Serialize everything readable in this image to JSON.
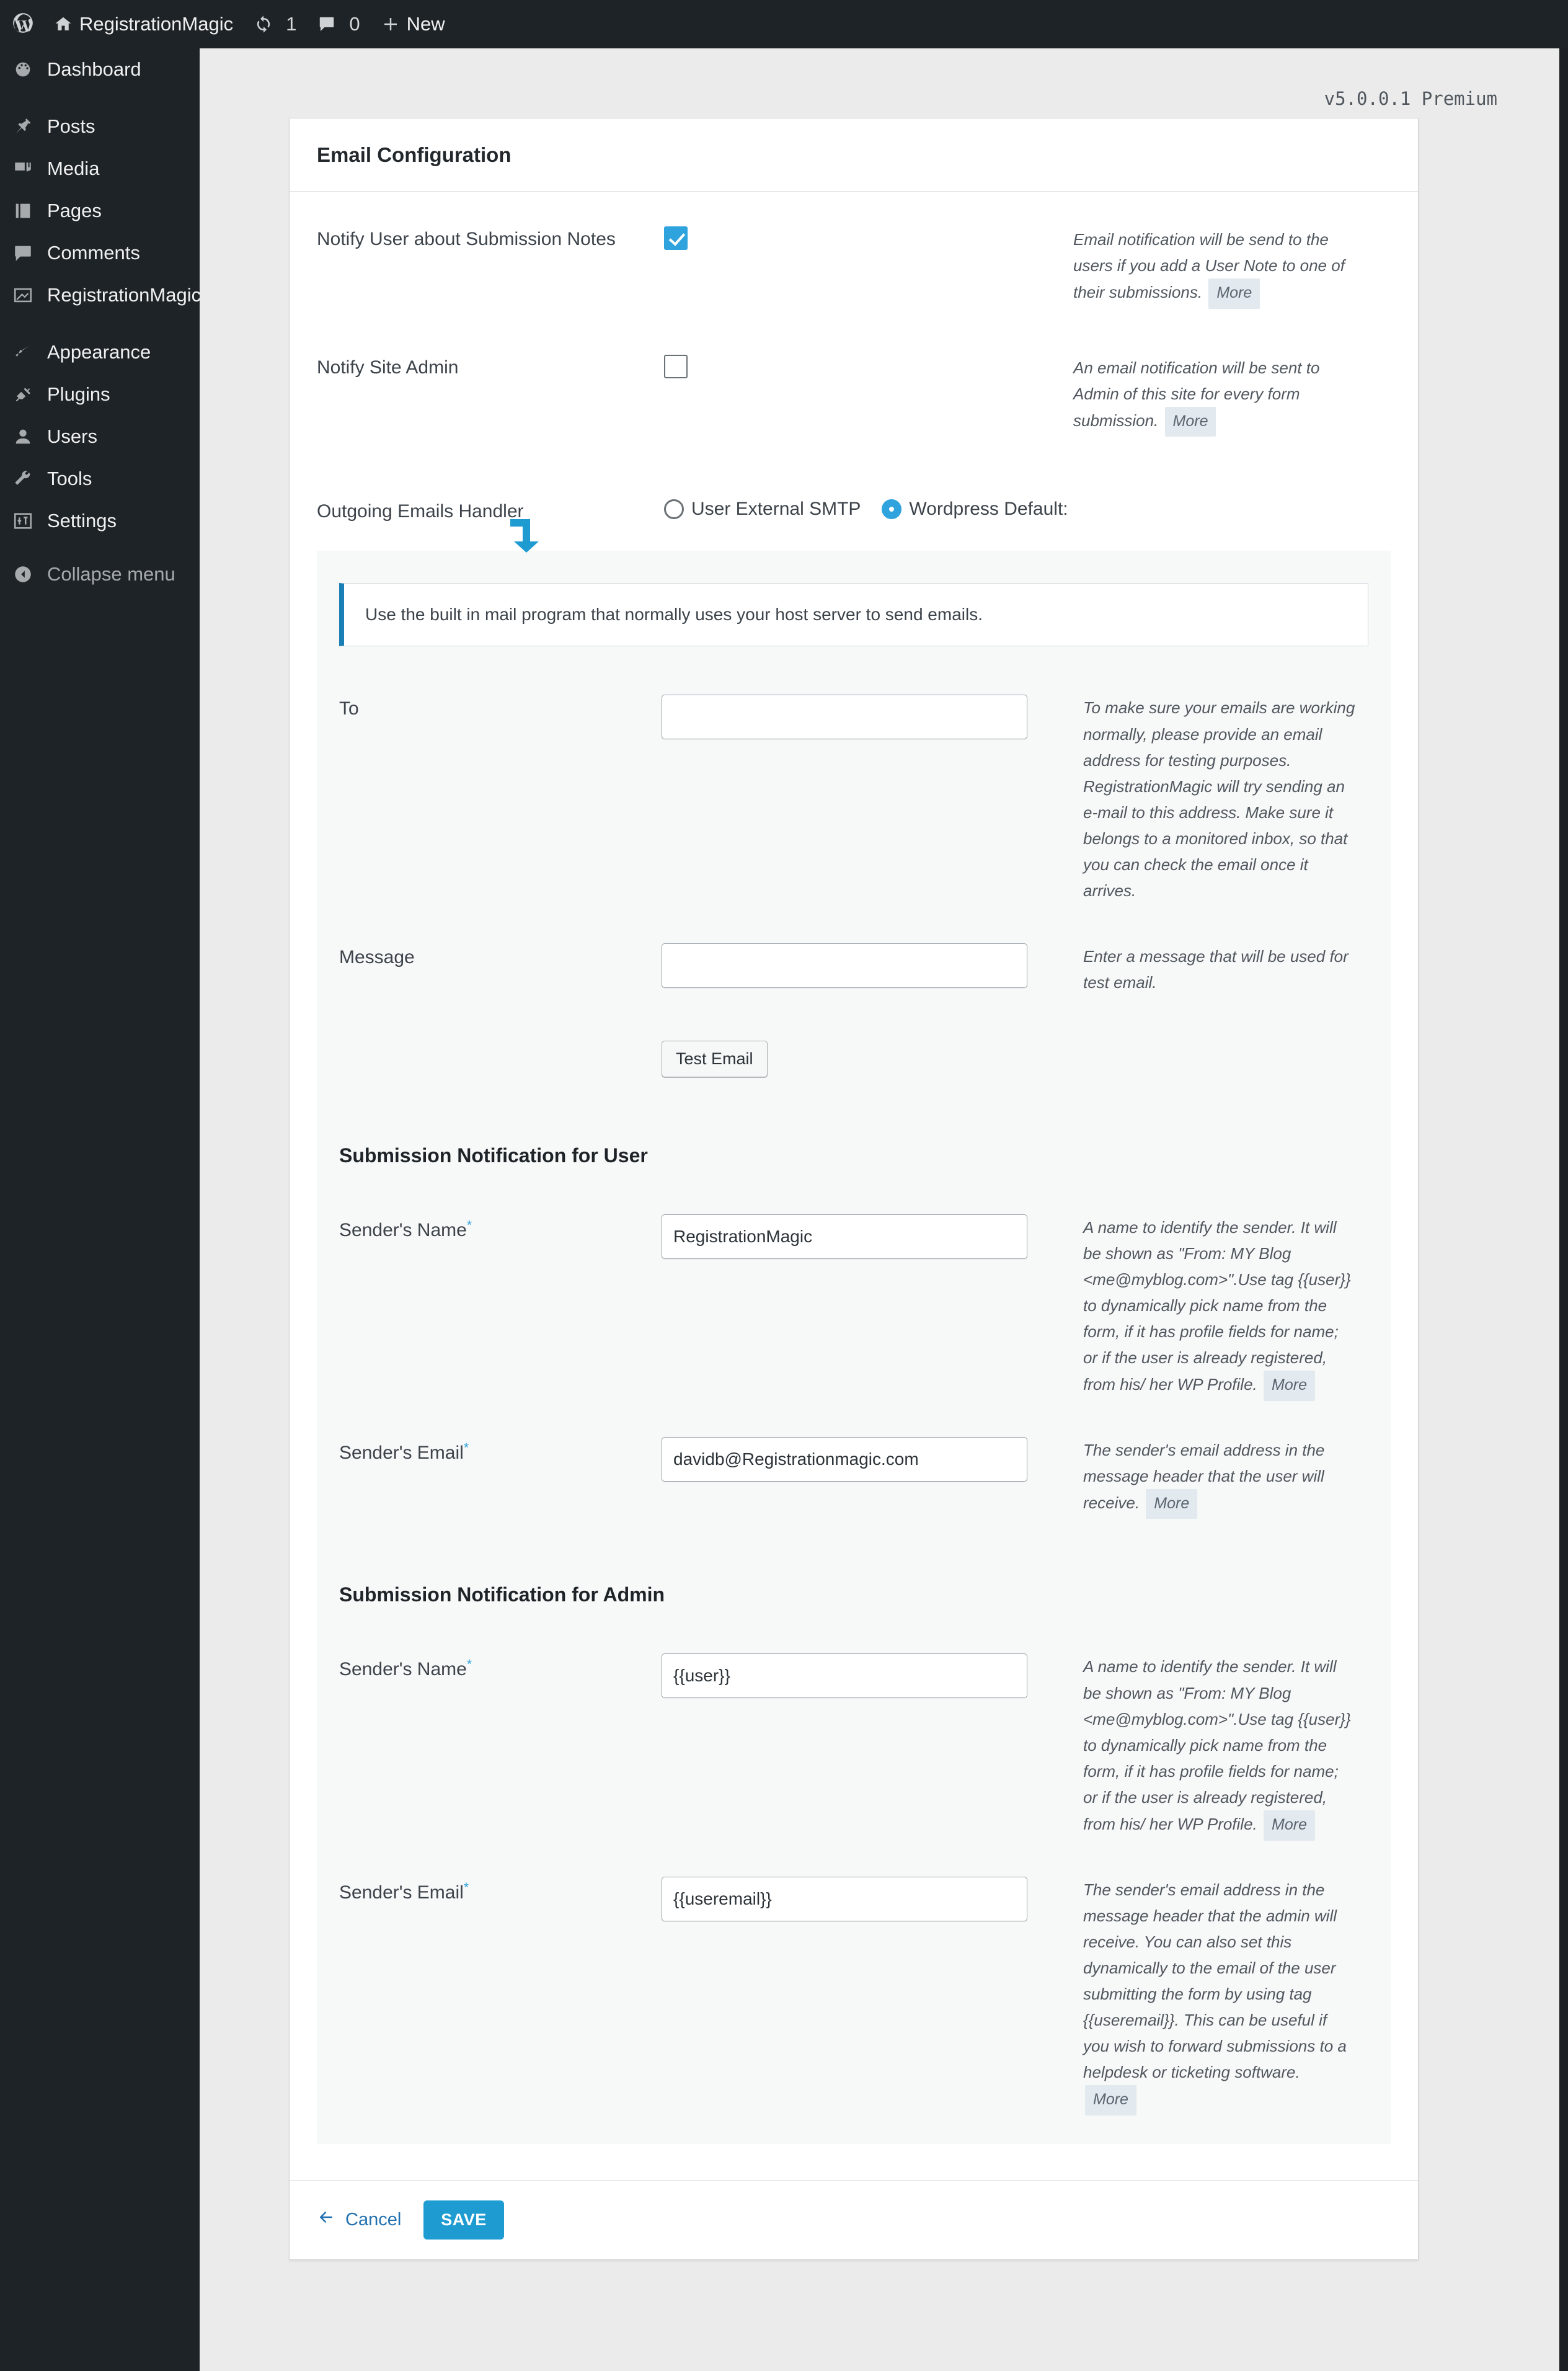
{
  "adminbar": {
    "site_name": "RegistrationMagic",
    "updates_count": "1",
    "comments_count": "0",
    "new_label": "New",
    "icons": {
      "wordpress": "wordpress-logo-icon",
      "home": "home-icon",
      "updates": "updates-icon",
      "comments": "comment-bubble-icon",
      "new": "plus-icon"
    }
  },
  "sidebar": {
    "items": [
      {
        "label": "Dashboard",
        "icon": "dashboard-icon",
        "separator": false
      },
      {
        "label": "Posts",
        "icon": "pin-icon",
        "separator": true
      },
      {
        "label": "Media",
        "icon": "media-icon",
        "separator": false
      },
      {
        "label": "Pages",
        "icon": "pages-icon",
        "separator": false
      },
      {
        "label": "Comments",
        "icon": "comment-bubble-icon",
        "separator": false
      },
      {
        "label": "RegistrationMagic",
        "icon": "registrationmagic-icon",
        "separator": false
      },
      {
        "label": "Appearance",
        "icon": "paintbrush-icon",
        "separator": true
      },
      {
        "label": "Plugins",
        "icon": "plug-icon",
        "separator": false
      },
      {
        "label": "Users",
        "icon": "user-icon",
        "separator": false
      },
      {
        "label": "Tools",
        "icon": "wrench-icon",
        "separator": false
      },
      {
        "label": "Settings",
        "icon": "settings-sliders-icon",
        "separator": false
      }
    ],
    "collapse_label": "Collapse menu",
    "collapse_icon": "collapse-arrow-icon"
  },
  "page": {
    "version": "v5.0.0.1 Premium",
    "card_title": "Email Configuration"
  },
  "notify_user": {
    "label": "Notify User about Submission Notes",
    "checked": true,
    "hint": "Email notification will be send to the users if you add a User Note to one of their submissions.",
    "more": "More"
  },
  "notify_admin": {
    "label": "Notify Site Admin",
    "checked": false,
    "hint": "An email notification will be sent to Admin of this site for every form submission.",
    "more": "More"
  },
  "handler": {
    "label": "Outgoing Emails Handler",
    "options": [
      {
        "label": "User External SMTP",
        "selected": false
      },
      {
        "label": "Wordpress Default:",
        "selected": true
      }
    ]
  },
  "notice": {
    "text": "Use the built in mail program that normally uses your host server to send emails."
  },
  "test_email": {
    "to_label": "To",
    "to_value": "",
    "to_hint": "To make sure your emails are working normally, please provide an email address for testing purposes. RegistrationMagic will try sending an e-mail to this address. Make sure it belongs to a monitored inbox, so that you can check the email once it arrives.",
    "message_label": "Message",
    "message_value": "",
    "message_hint": "Enter a message that will be used for test email.",
    "button_label": "Test Email"
  },
  "user_section": {
    "title": "Submission Notification for User",
    "sender_name": {
      "label": "Sender's Name",
      "required": "*",
      "value": "RegistrationMagic",
      "hint": "A name to identify the sender. It will be shown as \"From: MY Blog <me@myblog.com>\".Use tag {{user}} to dynamically pick name from the form, if it has profile fields for name; or if the user is already registered, from his/ her WP Profile.",
      "more": "More"
    },
    "sender_email": {
      "label": "Sender's Email",
      "required": "*",
      "value": "davidb@Registrationmagic.com",
      "hint": "The sender's email address in the message header that the user will receive.",
      "more": "More"
    }
  },
  "admin_section": {
    "title": "Submission Notification for Admin",
    "sender_name": {
      "label": "Sender's Name",
      "required": "*",
      "value": "{{user}}",
      "hint": "A name to identify the sender. It will be shown as \"From: MY Blog <me@myblog.com>\".Use tag {{user}} to dynamically pick name from the form, if it has profile fields for name; or if the user is already registered, from his/ her WP Profile.",
      "more": "More"
    },
    "sender_email": {
      "label": "Sender's Email",
      "required": "*",
      "value": "{{useremail}}",
      "hint": "The sender's email address in the message header that the admin will receive. You can also set this dynamically to the email of the user submitting the form by using tag {{useremail}}. This can be useful if you wish to forward submissions to a helpdesk or ticketing software.",
      "more": "More"
    }
  },
  "footer": {
    "cancel_label": "Cancel",
    "save_label": "SAVE",
    "back_arrow_icon": "arrow-left-icon"
  },
  "colors": {
    "accent": "#2ea3dd",
    "save_button": "#1e9bd1",
    "notice_bar": "#1a7fb5",
    "admin_dark": "#1d2327",
    "link": "#2271b1"
  }
}
